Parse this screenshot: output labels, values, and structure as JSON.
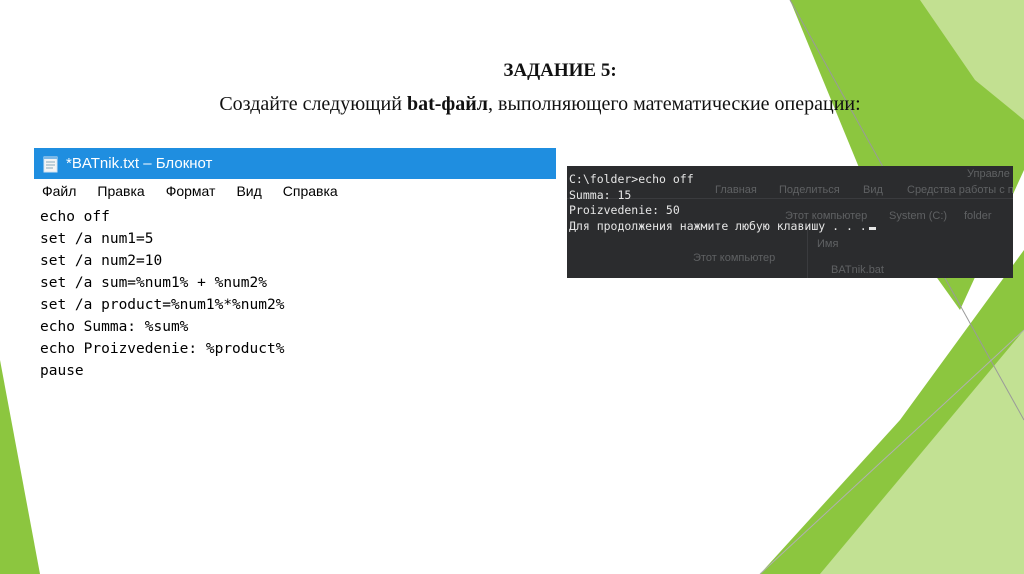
{
  "slide": {
    "title": "ЗАДАНИЕ 5:",
    "subtitle_pre": "Создайте следующий ",
    "subtitle_bold": "bat-файл",
    "subtitle_post": ", выполняющего математические операции:"
  },
  "colors": {
    "accent_green": "#8cc63f",
    "light_green": "#c8e29a",
    "notepad_titlebar": "#1f8ee0",
    "console_bg": "#2b2c2e"
  },
  "notepad": {
    "icon": "notepad-icon",
    "title": "*BATnik.txt – Блокнот",
    "menu": [
      "Файл",
      "Правка",
      "Формат",
      "Вид",
      "Справка"
    ],
    "lines": [
      "echo off",
      "set /a num1=5",
      "set /a num2=10",
      "set /a sum=%num1% + %num2%",
      "set /a product=%num1%*%num2%",
      "echo Summa: %sum%",
      "echo Proizvedenie: %product%",
      "pause"
    ]
  },
  "console": {
    "lines": [
      "C:\\folder>echo off",
      "Summa: 15",
      "Proizvedenie: 50",
      "Для продолжения нажмите любую клавишу . . ."
    ],
    "background_explorer": {
      "tabs": [
        "Главная",
        "Поделиться",
        "Вид",
        "Средства работы с пр"
      ],
      "top_right": "Управле",
      "path": [
        "Этот компьютер",
        "System (C:)",
        "folder"
      ],
      "column_name": "Имя",
      "nav_item": "Этот компьютер",
      "file": "BATnik.bat"
    }
  }
}
